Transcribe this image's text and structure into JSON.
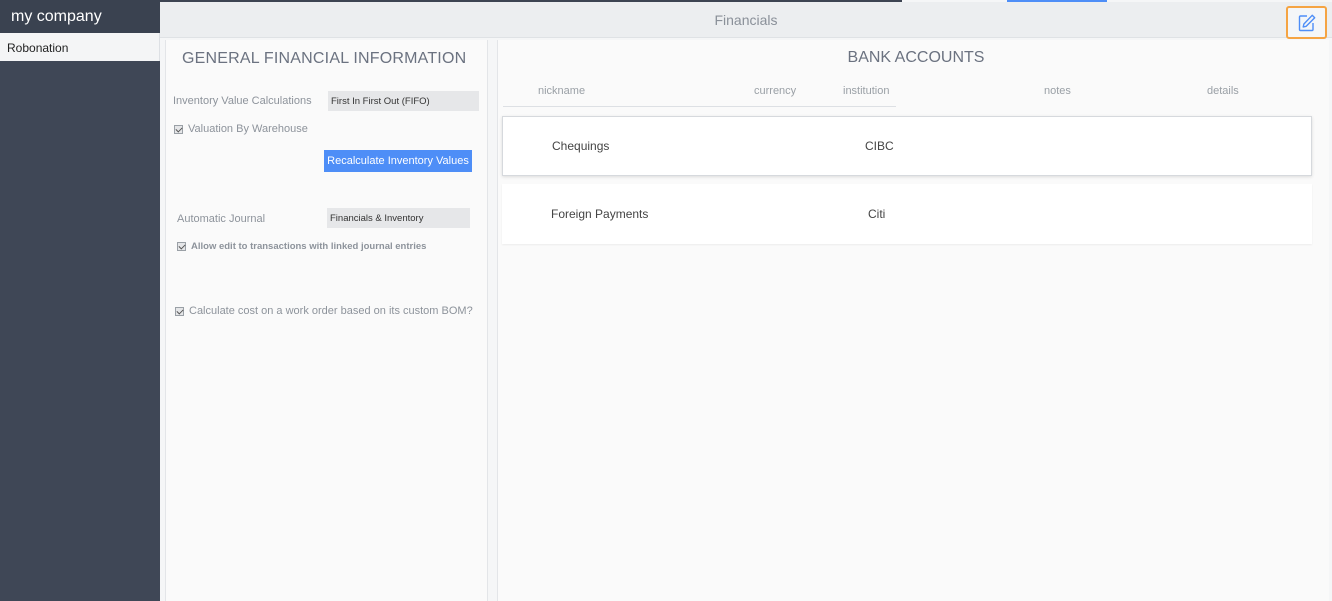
{
  "sidebar": {
    "company": "my company",
    "items": [
      {
        "label": "Robonation"
      }
    ]
  },
  "header": {
    "title": "Financials"
  },
  "general": {
    "title": "GENERAL FINANCIAL INFORMATION",
    "inventory_label": "Inventory Value Calculations",
    "inventory_value": "First In First Out (FIFO)",
    "valuation_label": "Valuation By Warehouse",
    "recalc_label": "Recalculate Inventory Values",
    "journal_label": "Automatic Journal",
    "journal_value": "Financials & Inventory",
    "allow_edit_label": "Allow edit to transactions with linked journal entries",
    "bom_label": "Calculate cost on a work order based on its custom BOM?"
  },
  "bank": {
    "title": "BANK ACCOUNTS",
    "columns": [
      "nickname",
      "currency",
      "institution",
      "notes",
      "details"
    ],
    "rows": [
      {
        "nickname": "Chequings",
        "currency": "",
        "institution": "CIBC",
        "notes": "",
        "details": ""
      },
      {
        "nickname": "Foreign Payments",
        "currency": "",
        "institution": "Citi",
        "notes": "",
        "details": ""
      }
    ]
  },
  "colors": {
    "accent": "#4e8ef7",
    "highlight": "#f5a443",
    "sidebar": "#3f4756"
  },
  "icons": {
    "edit": "edit-icon"
  }
}
